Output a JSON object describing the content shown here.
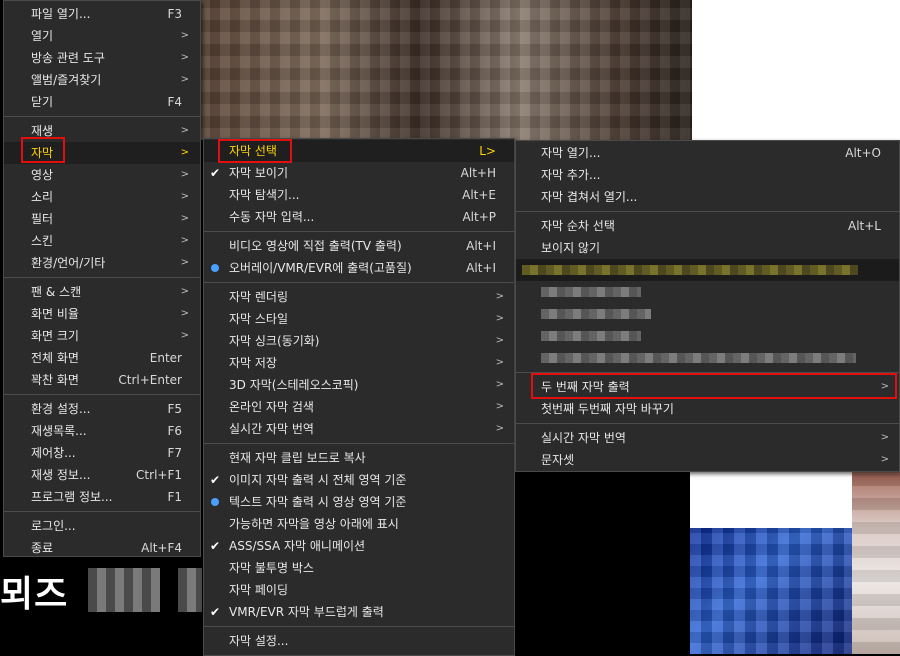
{
  "background": {
    "caption_text": "뫼즈"
  },
  "menu_main": {
    "items": [
      {
        "label": "파일 열기...",
        "shortcut": "F3"
      },
      {
        "label": "열기",
        "arrow": ">"
      },
      {
        "label": "방송 관련 도구",
        "arrow": ">"
      },
      {
        "label": "앨범/즐겨찾기",
        "arrow": ">"
      },
      {
        "label": "닫기",
        "shortcut": "F4"
      },
      {
        "label": "재생",
        "arrow": ">"
      },
      {
        "label": "자막",
        "arrow": ">"
      },
      {
        "label": "영상",
        "arrow": ">"
      },
      {
        "label": "소리",
        "arrow": ">"
      },
      {
        "label": "필터",
        "arrow": ">"
      },
      {
        "label": "스킨",
        "arrow": ">"
      },
      {
        "label": "환경/언어/기타",
        "arrow": ">"
      },
      {
        "label": "팬 & 스캔",
        "arrow": ">"
      },
      {
        "label": "화면 비율",
        "arrow": ">"
      },
      {
        "label": "화면 크기",
        "arrow": ">"
      },
      {
        "label": "전체 화면",
        "shortcut": "Enter"
      },
      {
        "label": "꽉찬 화면",
        "shortcut": "Ctrl+Enter"
      },
      {
        "label": "환경 설정...",
        "shortcut": "F5"
      },
      {
        "label": "재생목록...",
        "shortcut": "F6"
      },
      {
        "label": "제어창...",
        "shortcut": "F7"
      },
      {
        "label": "재생 정보...",
        "shortcut": "Ctrl+F1"
      },
      {
        "label": "프로그램 정보...",
        "shortcut": "F1"
      },
      {
        "label": "로그인..."
      },
      {
        "label": "종료",
        "shortcut": "Alt+F4"
      }
    ]
  },
  "menu_subtitle": {
    "items": [
      {
        "label": "자막 선택",
        "shortcut": "L>"
      },
      {
        "label": "자막 보이기",
        "shortcut": "Alt+H"
      },
      {
        "label": "자막 탐색기...",
        "shortcut": "Alt+E"
      },
      {
        "label": "수동 자막 입력...",
        "shortcut": "Alt+P"
      },
      {
        "label": "비디오 영상에 직접 출력(TV 출력)",
        "shortcut": "Alt+I"
      },
      {
        "label": "오버레이/VMR/EVR에 출력(고품질)",
        "shortcut": "Alt+I"
      },
      {
        "label": "자막 렌더링",
        "arrow": ">"
      },
      {
        "label": "자막 스타일",
        "arrow": ">"
      },
      {
        "label": "자막 싱크(동기화)",
        "arrow": ">"
      },
      {
        "label": "자막 저장",
        "arrow": ">"
      },
      {
        "label": "3D 자막(스테레오스코픽)",
        "arrow": ">"
      },
      {
        "label": "온라인 자막 검색",
        "arrow": ">"
      },
      {
        "label": "실시간 자막 번역",
        "arrow": ">"
      },
      {
        "label": "현재 자막 클립 보드로 복사"
      },
      {
        "label": "이미지 자막 출력 시 전체 영역 기준"
      },
      {
        "label": "텍스트 자막 출력 시 영상 영역 기준"
      },
      {
        "label": "가능하면 자막을 영상 아래에 표시"
      },
      {
        "label": "ASS/SSA 자막 애니메이션"
      },
      {
        "label": "자막 불투명 박스"
      },
      {
        "label": "자막 페이딩"
      },
      {
        "label": "VMR/EVR 자막 부드럽게 출력"
      },
      {
        "label": "자막 설정..."
      }
    ]
  },
  "menu_select": {
    "items": [
      {
        "label": "자막 열기...",
        "shortcut": "Alt+O"
      },
      {
        "label": "자막 추가..."
      },
      {
        "label": "자막 겹쳐서 열기..."
      },
      {
        "label": "자막 순차 선택",
        "shortcut": "Alt+L"
      },
      {
        "label": "보이지 않기"
      },
      {
        "label": "두 번째 자막 출력",
        "arrow": ">"
      },
      {
        "label": "첫번째 두번째 자막 바꾸기"
      },
      {
        "label": "실시간 자막 번역",
        "arrow": ">"
      },
      {
        "label": "문자셋",
        "arrow": ">"
      }
    ]
  },
  "colors": {
    "menu_bg": "#2b2b2b",
    "highlight_text": "#ffd400",
    "annotation_red": "#e01010",
    "radio_blue": "#4aa0ff"
  }
}
